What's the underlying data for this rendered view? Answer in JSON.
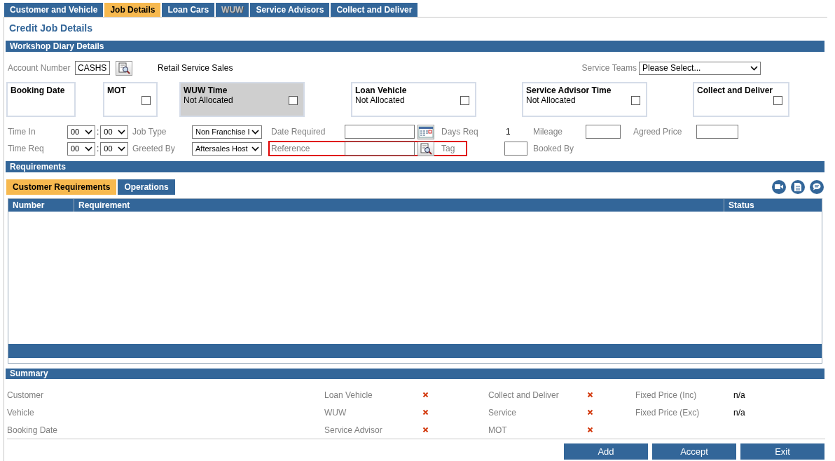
{
  "tabs": [
    {
      "label": "Customer and Vehicle",
      "selected": false,
      "disabled": false
    },
    {
      "label": "Job Details",
      "selected": true,
      "disabled": false
    },
    {
      "label": "Loan Cars",
      "selected": false,
      "disabled": false
    },
    {
      "label": "WUW",
      "selected": false,
      "disabled": true
    },
    {
      "label": "Service Advisors",
      "selected": false,
      "disabled": false
    },
    {
      "label": "Collect and Deliver",
      "selected": false,
      "disabled": false
    }
  ],
  "page_title": "Credit Job Details",
  "workshop": {
    "title": "Workshop Diary Details",
    "account_label": "Account Number",
    "account_value": "CASHS",
    "account_name": "Retail Service Sales",
    "service_teams_label": "Service Teams",
    "service_teams_value": "Please Select...",
    "boxes": [
      {
        "title": "Booking Date",
        "checkbox": false,
        "disabled": false
      },
      {
        "title": "MOT",
        "checkbox": true,
        "checked": false,
        "disabled": false
      },
      {
        "title": "WUW Time",
        "subtitle": "Not Allocated",
        "checkbox": true,
        "checked": false,
        "disabled": true
      },
      {
        "title": "Loan Vehicle",
        "subtitle": "Not Allocated",
        "checkbox": true,
        "checked": false,
        "disabled": false
      },
      {
        "title": "Service Advisor Time",
        "subtitle": "Not Allocated",
        "checkbox": true,
        "checked": false,
        "disabled": false
      },
      {
        "title": "Collect and Deliver",
        "checkbox": true,
        "checked": false,
        "disabled": false
      }
    ],
    "time_in": {
      "label": "Time In",
      "hour": "00",
      "minute": "00",
      "separator": ":"
    },
    "time_req": {
      "label": "Time Req",
      "hour": "00",
      "minute": "00",
      "separator": ":"
    },
    "job_type": {
      "label": "Job Type",
      "value": "Non Franchise I"
    },
    "greeted_by": {
      "label": "Greeted By",
      "value": "Aftersales Host"
    },
    "date_required": {
      "label": "Date Required"
    },
    "reference": {
      "label": "Reference",
      "highlighted": true
    },
    "days_req": {
      "label": "Days Req",
      "value": "1"
    },
    "tag": {
      "label": "Tag"
    },
    "mileage": {
      "label": "Mileage"
    },
    "booked_by": {
      "label": "Booked By"
    },
    "agreed_price": {
      "label": "Agreed Price"
    }
  },
  "requirements": {
    "title": "Requirements",
    "tabs": [
      {
        "label": "Customer Requirements",
        "selected": true
      },
      {
        "label": "Operations",
        "selected": false
      }
    ],
    "columns": [
      "Number",
      "Requirement",
      "Status"
    ]
  },
  "summary": {
    "title": "Summary",
    "details": [
      "Customer",
      "Vehicle",
      "Booking Date"
    ],
    "checks_a": [
      {
        "label": "Loan Vehicle",
        "done": false
      },
      {
        "label": "WUW",
        "done": false
      },
      {
        "label": "Service Advisor",
        "done": false
      }
    ],
    "checks_b": [
      {
        "label": "Collect and Deliver",
        "done": false
      },
      {
        "label": "Service",
        "done": false
      },
      {
        "label": "MOT",
        "done": false
      }
    ],
    "prices": [
      {
        "label": "Fixed Price (Inc)",
        "value": "n/a"
      },
      {
        "label": "Fixed Price (Exc)",
        "value": "n/a"
      }
    ]
  },
  "buttons": [
    "Add",
    "Accept",
    "Exit"
  ]
}
